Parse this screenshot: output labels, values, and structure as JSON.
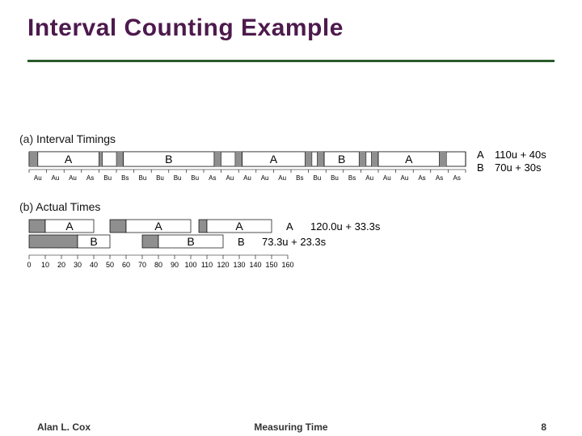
{
  "title": "Interval Counting Example",
  "footer": {
    "author": "Alan L. Cox",
    "center": "Measuring Time",
    "page": "8"
  },
  "panelA": {
    "label": "(a)",
    "title": "Interval Timings",
    "totalUnits": 250,
    "tickEvery": 10,
    "segments": [
      {
        "type": "sys",
        "len": 5
      },
      {
        "type": "label",
        "text": "A",
        "len": 35
      },
      {
        "type": "sys",
        "len": 2
      },
      {
        "type": "idle",
        "len": 8
      },
      {
        "type": "sys",
        "len": 4
      },
      {
        "type": "label",
        "text": "B",
        "len": 52
      },
      {
        "type": "sys",
        "len": 4
      },
      {
        "type": "idle",
        "len": 8
      },
      {
        "type": "sys",
        "len": 4
      },
      {
        "type": "label",
        "text": "A",
        "len": 36
      },
      {
        "type": "sys",
        "len": 4
      },
      {
        "type": "idle",
        "len": 3
      },
      {
        "type": "sys",
        "len": 4
      },
      {
        "type": "label",
        "text": "B",
        "len": 20
      },
      {
        "type": "sys",
        "len": 4
      },
      {
        "type": "idle",
        "len": 3
      },
      {
        "type": "sys",
        "len": 4
      },
      {
        "type": "label",
        "text": "A",
        "len": 35
      },
      {
        "type": "sys",
        "len": 4
      },
      {
        "type": "idle",
        "len": 7
      }
    ],
    "tickLabels": [
      "Au",
      "Au",
      "Au",
      "As",
      "Bu",
      "Bs",
      "Bu",
      "Bu",
      "Bu",
      "Bu",
      "As",
      "Au",
      "Au",
      "Au",
      "Au",
      "Bs",
      "Bu",
      "Bu",
      "Bs",
      "Au",
      "Au",
      "Au",
      "As",
      "As",
      "As"
    ],
    "results": [
      {
        "name": "A",
        "text": "110u + 40s"
      },
      {
        "name": "B",
        "text": "70u + 30s"
      }
    ]
  },
  "panelB": {
    "label": "(b)",
    "title": "Actual Times",
    "axisMax": 160,
    "axisStep": 10,
    "rowA": {
      "name": "A",
      "segments": [
        {
          "type": "sys",
          "start": 0,
          "end": 10
        },
        {
          "type": "label",
          "text": "A",
          "start": 10,
          "end": 40
        },
        {
          "type": "sys",
          "start": 50,
          "end": 60
        },
        {
          "type": "label",
          "text": "A",
          "start": 60,
          "end": 100
        },
        {
          "type": "sys",
          "start": 105,
          "end": 110
        },
        {
          "type": "label",
          "text": "A",
          "start": 110,
          "end": 150
        }
      ],
      "result": "120.0u + 33.3s"
    },
    "rowB": {
      "name": "B",
      "segments": [
        {
          "type": "sys",
          "start": 0,
          "end": 30
        },
        {
          "type": "label",
          "text": "B",
          "start": 30,
          "end": 50
        },
        {
          "type": "sys",
          "start": 70,
          "end": 80
        },
        {
          "type": "label",
          "text": "B",
          "start": 80,
          "end": 120
        }
      ],
      "result": "73.3u + 23.3s"
    }
  },
  "chart_data": {
    "type": "table",
    "title": "Interval Counting Example",
    "panelA": {
      "tick_labels": [
        "Au",
        "Au",
        "Au",
        "As",
        "Bu",
        "Bs",
        "Bu",
        "Bu",
        "Bu",
        "Bu",
        "As",
        "Au",
        "Au",
        "Au",
        "Au",
        "Bs",
        "Bu",
        "Bu",
        "Bs",
        "Au",
        "Au",
        "Au",
        "As",
        "As",
        "As"
      ],
      "results": {
        "A": "110u + 40s",
        "B": "70u + 30s"
      }
    },
    "panelB": {
      "axis": {
        "min": 0,
        "max": 160,
        "step": 10
      },
      "results": {
        "A": "120.0u + 33.3s",
        "B": "73.3u + 23.3s"
      }
    }
  }
}
